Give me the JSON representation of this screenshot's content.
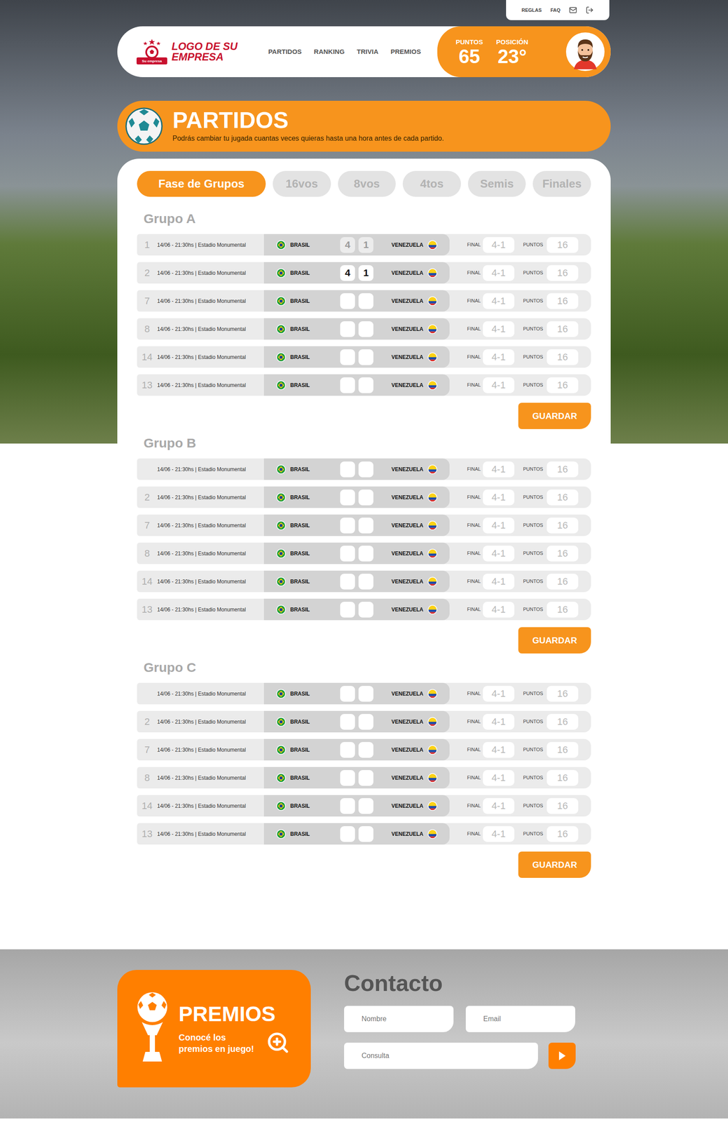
{
  "top_links": [
    "REGLAS",
    "FAQ"
  ],
  "logo": {
    "badge": "Su empresa",
    "lines": [
      "LOGO DE SU",
      "EMPRESA"
    ]
  },
  "nav": [
    {
      "label": "PARTIDOS"
    },
    {
      "label": "RANKING"
    },
    {
      "label": "TRIVIA"
    },
    {
      "label": "PREMIOS"
    }
  ],
  "stats": [
    {
      "label": "PUNTOS",
      "value": "65"
    },
    {
      "label": "POSICIÓN",
      "value": "23°"
    }
  ],
  "banner": {
    "title": "PARTIDOS",
    "subtitle": "Podrás cambiar tu jugada cuantas veces quieras hasta una hora antes de cada partido."
  },
  "tabs": [
    {
      "label": "Fase de Grupos",
      "selected": true
    },
    {
      "label": "16vos",
      "selected": false
    },
    {
      "label": "8vos",
      "selected": false
    },
    {
      "label": "4tos",
      "selected": false
    },
    {
      "label": "Semis",
      "selected": false
    },
    {
      "label": "Finales",
      "selected": false
    }
  ],
  "groups": [
    {
      "title": "Grupo A",
      "button": "GUARDAR",
      "rows": [
        {
          "number": "1",
          "info": "14/06 - 21:30hs | Estadio Monumental",
          "home": "BRASIL",
          "away": "VENEZUELA",
          "home_score": "4",
          "away_score": "1",
          "locked": true,
          "final_label": "FINAL",
          "final": "4-1",
          "points_label": "PUNTOS",
          "points": "16"
        },
        {
          "number": "2",
          "info": "14/06 - 21:30hs | Estadio Monumental",
          "home": "BRASIL",
          "away": "VENEZUELA",
          "home_score": "4",
          "away_score": "1",
          "locked": false,
          "final_label": "FINAL",
          "final": "4-1",
          "points_label": "PUNTOS",
          "points": "16"
        },
        {
          "number": "7",
          "info": "14/06 - 21:30hs | Estadio Monumental",
          "home": "BRASIL",
          "away": "VENEZUELA",
          "home_score": "",
          "away_score": "",
          "locked": false,
          "final_label": "FINAL",
          "final": "4-1",
          "points_label": "PUNTOS",
          "points": "16"
        },
        {
          "number": "8",
          "info": "14/06 - 21:30hs | Estadio Monumental",
          "home": "BRASIL",
          "away": "VENEZUELA",
          "home_score": "",
          "away_score": "",
          "locked": false,
          "final_label": "FINAL",
          "final": "4-1",
          "points_label": "PUNTOS",
          "points": "16"
        },
        {
          "number": "14",
          "info": "14/06 - 21:30hs | Estadio Monumental",
          "home": "BRASIL",
          "away": "VENEZUELA",
          "home_score": "",
          "away_score": "",
          "locked": false,
          "final_label": "FINAL",
          "final": "4-1",
          "points_label": "PUNTOS",
          "points": "16"
        },
        {
          "number": "13",
          "info": "14/06 - 21:30hs | Estadio Monumental",
          "home": "BRASIL",
          "away": "VENEZUELA",
          "home_score": "",
          "away_score": "",
          "locked": false,
          "final_label": "FINAL",
          "final": "4-1",
          "points_label": "PUNTOS",
          "points": "16"
        }
      ]
    },
    {
      "title": "Grupo B",
      "button": "GUARDAR",
      "rows": [
        {
          "number": "",
          "info": "14/06 - 21:30hs | Estadio Monumental",
          "home": "BRASIL",
          "away": "VENEZUELA",
          "home_score": "",
          "away_score": "",
          "locked": false,
          "final_label": "FINAL",
          "final": "4-1",
          "points_label": "PUNTOS",
          "points": "16"
        },
        {
          "number": "2",
          "info": "14/06 - 21:30hs | Estadio Monumental",
          "home": "BRASIL",
          "away": "VENEZUELA",
          "home_score": "",
          "away_score": "",
          "locked": false,
          "final_label": "FINAL",
          "final": "4-1",
          "points_label": "PUNTOS",
          "points": "16"
        },
        {
          "number": "7",
          "info": "14/06 - 21:30hs | Estadio Monumental",
          "home": "BRASIL",
          "away": "VENEZUELA",
          "home_score": "",
          "away_score": "",
          "locked": false,
          "final_label": "FINAL",
          "final": "4-1",
          "points_label": "PUNTOS",
          "points": "16"
        },
        {
          "number": "8",
          "info": "14/06 - 21:30hs | Estadio Monumental",
          "home": "BRASIL",
          "away": "VENEZUELA",
          "home_score": "",
          "away_score": "",
          "locked": false,
          "final_label": "FINAL",
          "final": "4-1",
          "points_label": "PUNTOS",
          "points": "16"
        },
        {
          "number": "14",
          "info": "14/06 - 21:30hs | Estadio Monumental",
          "home": "BRASIL",
          "away": "VENEZUELA",
          "home_score": "",
          "away_score": "",
          "locked": false,
          "final_label": "FINAL",
          "final": "4-1",
          "points_label": "PUNTOS",
          "points": "16"
        },
        {
          "number": "13",
          "info": "14/06 - 21:30hs | Estadio Monumental",
          "home": "BRASIL",
          "away": "VENEZUELA",
          "home_score": "",
          "away_score": "",
          "locked": false,
          "final_label": "FINAL",
          "final": "4-1",
          "points_label": "PUNTOS",
          "points": "16"
        }
      ]
    },
    {
      "title": "Grupo C",
      "button": "GUARDAR",
      "rows": [
        {
          "number": "",
          "info": "14/06 - 21:30hs | Estadio Monumental",
          "home": "BRASIL",
          "away": "VENEZUELA",
          "home_score": "",
          "away_score": "",
          "locked": false,
          "final_label": "FINAL",
          "final": "4-1",
          "points_label": "PUNTOS",
          "points": "16"
        },
        {
          "number": "2",
          "info": "14/06 - 21:30hs | Estadio Monumental",
          "home": "BRASIL",
          "away": "VENEZUELA",
          "home_score": "",
          "away_score": "",
          "locked": false,
          "final_label": "FINAL",
          "final": "4-1",
          "points_label": "PUNTOS",
          "points": "16"
        },
        {
          "number": "7",
          "info": "14/06 - 21:30hs | Estadio Monumental",
          "home": "BRASIL",
          "away": "VENEZUELA",
          "home_score": "",
          "away_score": "",
          "locked": false,
          "final_label": "FINAL",
          "final": "4-1",
          "points_label": "PUNTOS",
          "points": "16"
        },
        {
          "number": "8",
          "info": "14/06 - 21:30hs | Estadio Monumental",
          "home": "BRASIL",
          "away": "VENEZUELA",
          "home_score": "",
          "away_score": "",
          "locked": false,
          "final_label": "FINAL",
          "final": "4-1",
          "points_label": "PUNTOS",
          "points": "16"
        },
        {
          "number": "14",
          "info": "14/06 - 21:30hs | Estadio Monumental",
          "home": "BRASIL",
          "away": "VENEZUELA",
          "home_score": "",
          "away_score": "",
          "locked": false,
          "final_label": "FINAL",
          "final": "4-1",
          "points_label": "PUNTOS",
          "points": "16"
        },
        {
          "number": "13",
          "info": "14/06 - 21:30hs | Estadio Monumental",
          "home": "BRASIL",
          "away": "VENEZUELA",
          "home_score": "",
          "away_score": "",
          "locked": false,
          "final_label": "FINAL",
          "final": "4-1",
          "points_label": "PUNTOS",
          "points": "16"
        }
      ]
    }
  ],
  "premios": {
    "title": "PREMIOS",
    "text": "Conocé los premios en juego!"
  },
  "contact": {
    "title": "Contacto",
    "fields": [
      {
        "placeholder": "Nombre"
      },
      {
        "placeholder": "Email"
      },
      {
        "placeholder": "Consulta"
      }
    ]
  }
}
